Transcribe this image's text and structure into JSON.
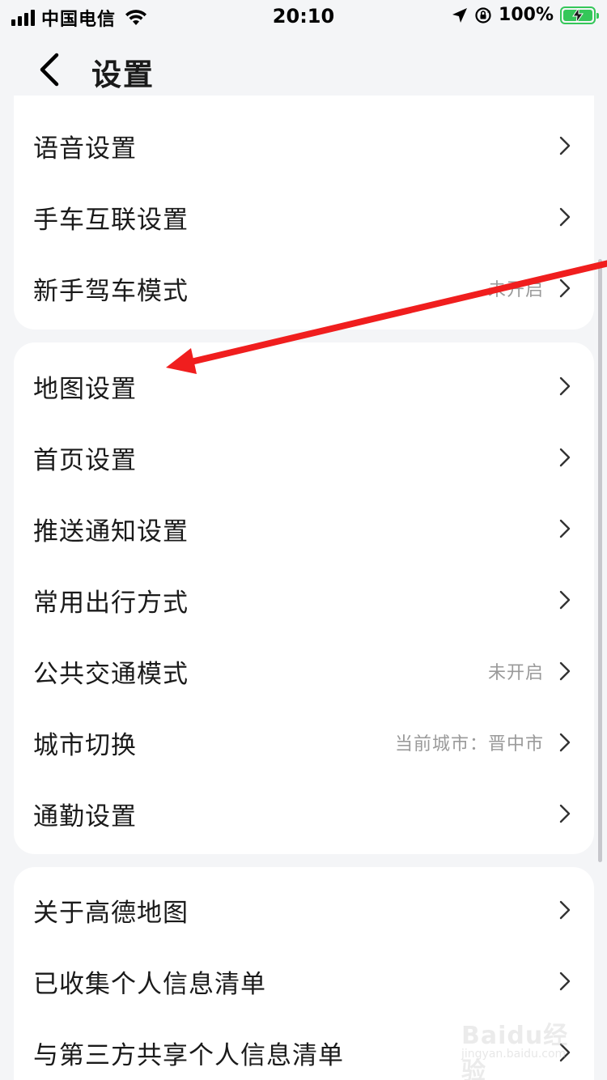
{
  "status_bar": {
    "carrier": "中国电信",
    "time": "20:10",
    "battery_pct": "100%"
  },
  "nav": {
    "title": "设置"
  },
  "sections": [
    {
      "items": [
        {
          "label": "语音设置",
          "value": ""
        },
        {
          "label": "手车互联设置",
          "value": ""
        },
        {
          "label": "新手驾车模式",
          "value": "未开启"
        }
      ]
    },
    {
      "items": [
        {
          "label": "地图设置",
          "value": ""
        },
        {
          "label": "首页设置",
          "value": ""
        },
        {
          "label": "推送通知设置",
          "value": ""
        },
        {
          "label": "常用出行方式",
          "value": ""
        },
        {
          "label": "公共交通模式",
          "value": "未开启"
        },
        {
          "label": "城市切换",
          "value": "当前城市：晋中市"
        },
        {
          "label": "通勤设置",
          "value": ""
        }
      ]
    },
    {
      "items": [
        {
          "label": "关于高德地图",
          "value": ""
        },
        {
          "label": "已收集个人信息清单",
          "value": ""
        },
        {
          "label": "与第三方共享个人信息清单",
          "value": ""
        }
      ]
    }
  ],
  "watermark": {
    "brand": "Baidu经验",
    "sub": "jingyan.baidu.com"
  },
  "colors": {
    "annotation_arrow": "#f01e1e",
    "battery": "#34c759",
    "secondary_text": "#9a9a9a"
  },
  "icons": [
    "signal-icon",
    "wifi-icon",
    "location-icon",
    "rotation-lock-icon",
    "battery-icon",
    "back-icon",
    "chevron-right-icon"
  ]
}
